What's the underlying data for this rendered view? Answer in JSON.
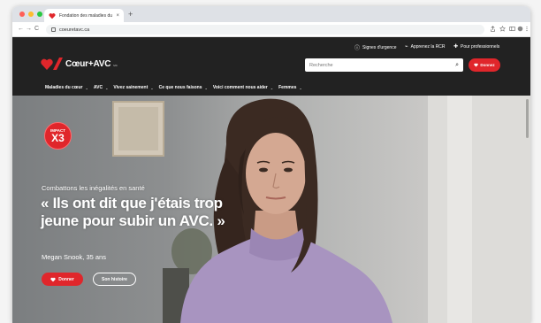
{
  "browser": {
    "tab_title": "Fondation des maladies du cœ",
    "tab_close": "×",
    "new_tab": "+",
    "url": "coeuretavc.ca",
    "nav": {
      "back": "←",
      "forward": "→",
      "reload": "C"
    },
    "toolbar_icons": [
      "share-icon",
      "star-icon",
      "sidebar-icon",
      "extensions-icon",
      "menu-icon"
    ]
  },
  "header": {
    "utility_links": [
      {
        "icon": "ⓘ",
        "label": "Signes d'urgence"
      },
      {
        "icon": "⌁",
        "label": "Apprenez la RCR"
      },
      {
        "icon": "✚",
        "label": "Pour professionnels"
      }
    ],
    "logo_text": "Cœur+AVC",
    "logo_sub": "MC",
    "search_placeholder": "Recherche",
    "search_icon": "⌕",
    "donate_label": "Donnez",
    "nav": [
      {
        "label": "Maladies du cœur",
        "chevron": "⌄"
      },
      {
        "label": "AVC",
        "chevron": "⌄"
      },
      {
        "label": "Vivez sainement",
        "chevron": "⌄"
      },
      {
        "label": "Ce que nous faisons",
        "chevron": "⌄"
      },
      {
        "label": "Voici comment nous aider",
        "chevron": "⌄"
      },
      {
        "label": "Femmes",
        "chevron": "⌄"
      }
    ]
  },
  "hero": {
    "badge_top": "IMPACT",
    "badge_big": "X3",
    "kicker": "Combattons les inégalités en santé",
    "quote": "« Ils ont dit que j'étais trop jeune pour subir un AVC. »",
    "byline": "Megan Snook, 35 ans",
    "donate_label": "Donner",
    "story_label": "Son histoire"
  },
  "colors": {
    "brand_red": "#e0262b",
    "header_dark": "#222222"
  }
}
